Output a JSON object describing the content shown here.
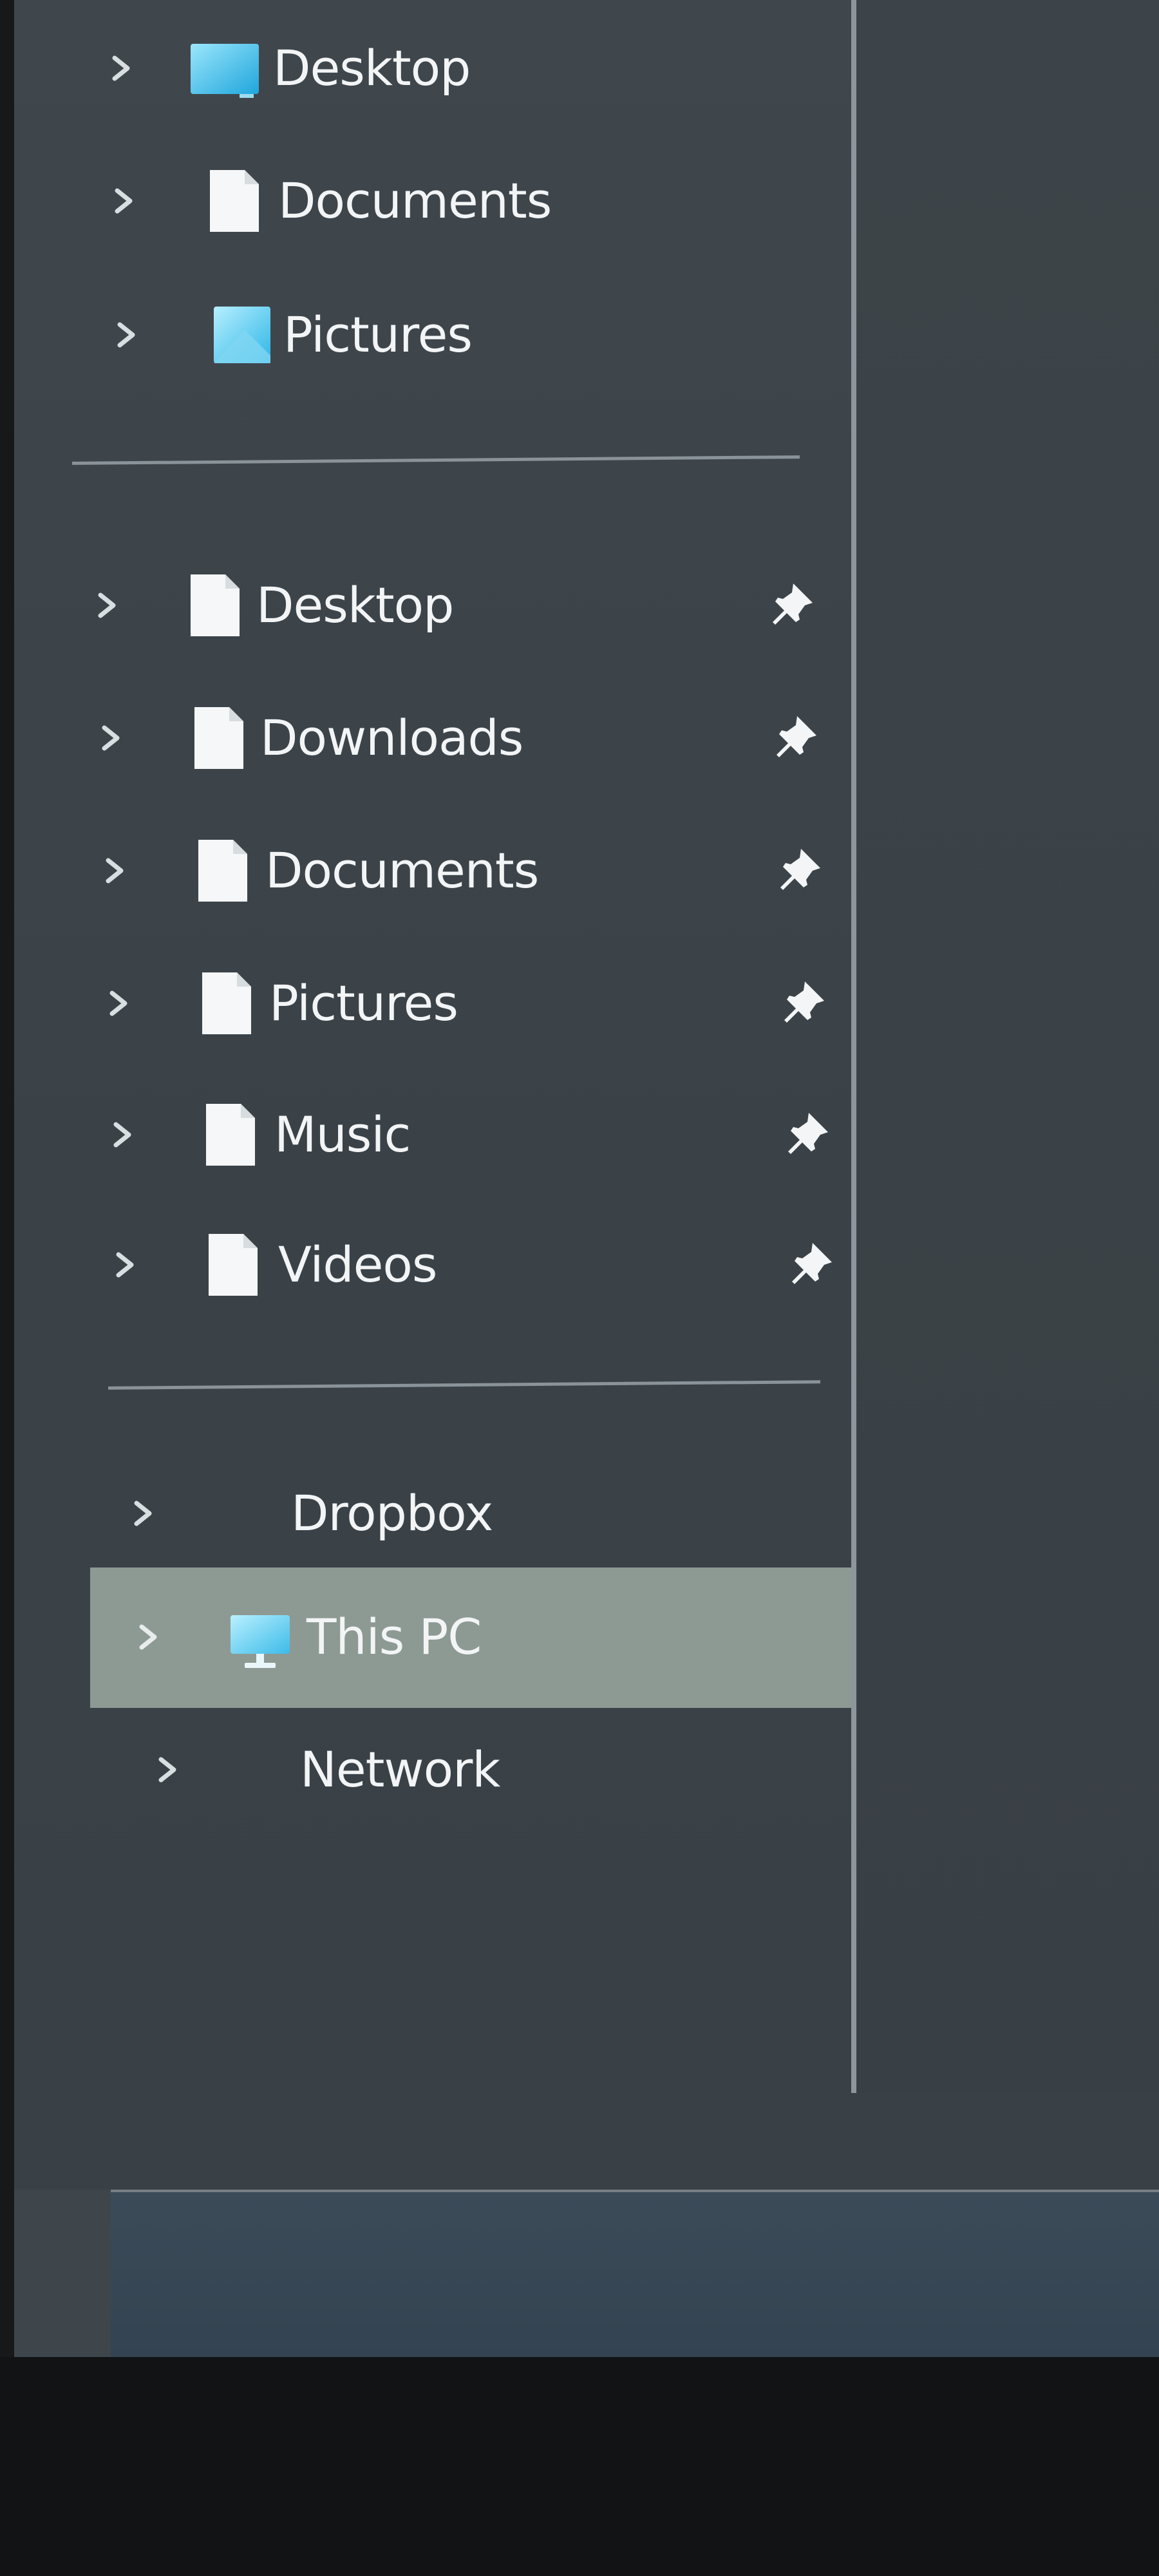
{
  "navigation_pane": {
    "top_group": [
      {
        "label": "Desktop",
        "icon": "desktop-folder-icon"
      },
      {
        "label": "Documents",
        "icon": "documents-folder-icon"
      },
      {
        "label": "Pictures",
        "icon": "pictures-folder-icon"
      }
    ],
    "quick_access": [
      {
        "label": "Desktop",
        "icon": "folder-icon",
        "pinned": true
      },
      {
        "label": "Downloads",
        "icon": "folder-icon",
        "pinned": true
      },
      {
        "label": "Documents",
        "icon": "folder-icon",
        "pinned": true
      },
      {
        "label": "Pictures",
        "icon": "folder-icon",
        "pinned": true
      },
      {
        "label": "Music",
        "icon": "folder-icon",
        "pinned": true
      },
      {
        "label": "Videos",
        "icon": "folder-icon",
        "pinned": true
      }
    ],
    "locations": [
      {
        "label": "Dropbox",
        "icon": "none",
        "selected": false
      },
      {
        "label": "This PC",
        "icon": "monitor-icon",
        "selected": true
      },
      {
        "label": "Network",
        "icon": "none",
        "selected": false
      }
    ]
  },
  "colors": {
    "pane_background": "#3e464c",
    "selected_row": "#8d9a94",
    "text": "#f2f4f5",
    "chevron": "#d9dee1",
    "accent_blue": "#4ec3ec",
    "divider": "#8a9399"
  }
}
